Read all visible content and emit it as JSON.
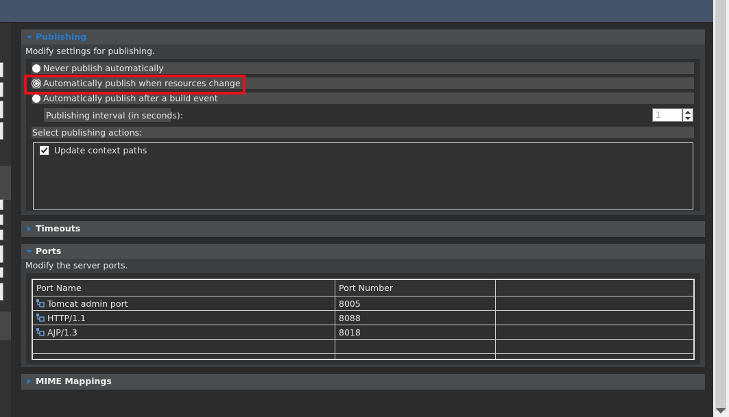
{
  "publishing": {
    "title": "Publishing",
    "description": "Modify settings for publishing.",
    "options": [
      {
        "label": "Never publish automatically"
      },
      {
        "label": "Automatically publish when resources change"
      },
      {
        "label": "Automatically publish after a build event"
      }
    ],
    "interval_label": "Publishing interval (in seconds):",
    "interval_value": "1",
    "actions_label": "Select publishing actions:",
    "action_item": "Update context paths"
  },
  "timeouts": {
    "title": "Timeouts"
  },
  "ports": {
    "title": "Ports",
    "description": "Modify the server ports.",
    "columns": [
      "Port Name",
      "Port Number",
      ""
    ],
    "rows": [
      {
        "name": "Tomcat admin port",
        "number": "8005"
      },
      {
        "name": "HTTP/1.1",
        "number": "8088"
      },
      {
        "name": "AJP/1.3",
        "number": "8018"
      }
    ]
  },
  "mime": {
    "title": "MIME Mappings"
  },
  "colors": {
    "accent": "#2a78c8",
    "highlight": "#e8101a"
  }
}
